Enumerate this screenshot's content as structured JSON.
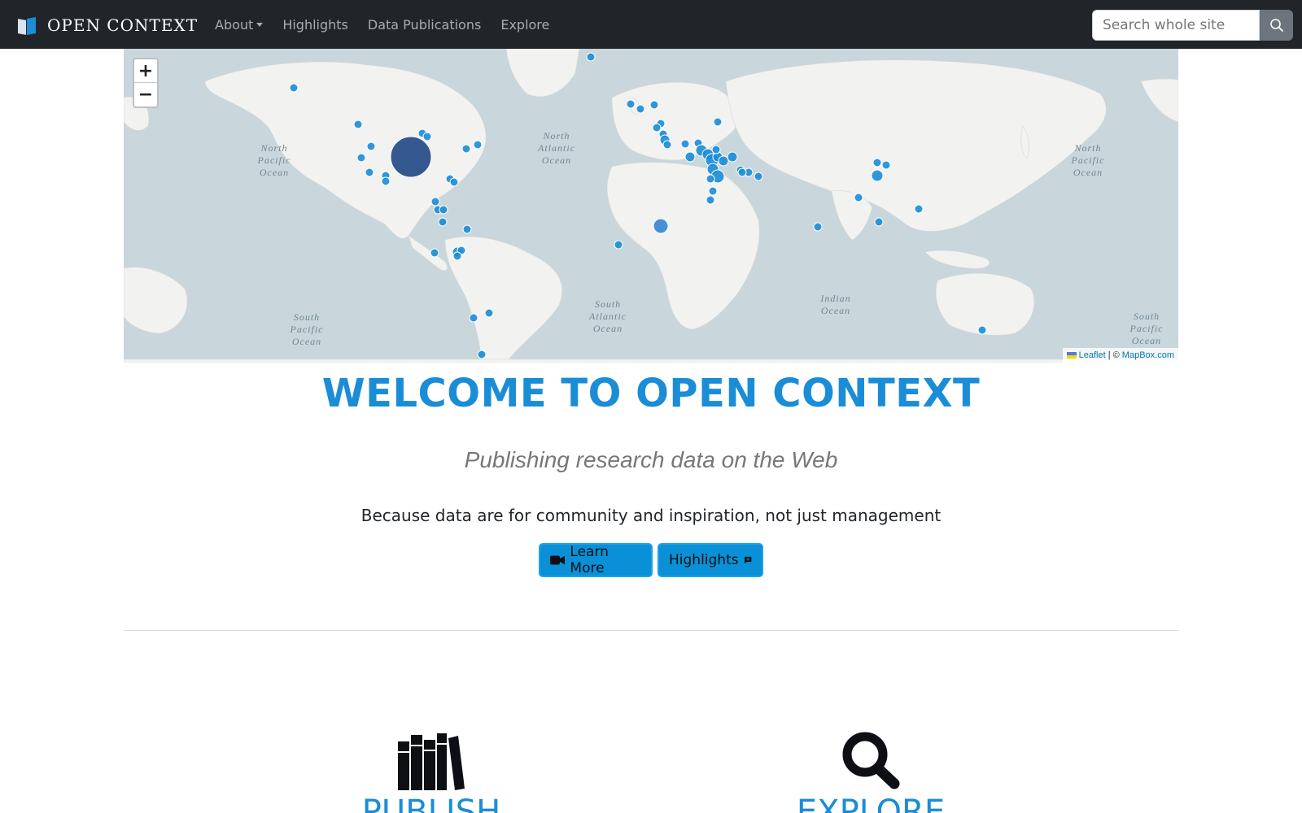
{
  "navbar": {
    "brand": "OPEN CONTEXT",
    "links": [
      {
        "label": "About",
        "dropdown": true
      },
      {
        "label": "Highlights",
        "dropdown": false
      },
      {
        "label": "Data Publications",
        "dropdown": false
      },
      {
        "label": "Explore",
        "dropdown": false
      }
    ],
    "search_placeholder": "Search whole site",
    "search_icon": "search-icon"
  },
  "map": {
    "zoom_in": "+",
    "zoom_out": "−",
    "attribution": {
      "leaflet": "Leaflet",
      "separator": " | © ",
      "provider": "MapBox.com"
    },
    "oceans": [
      "North Pacific Ocean",
      "North Atlantic Ocean",
      "North Pacific Ocean",
      "South Pacific Ocean",
      "South Atlantic Ocean",
      "Indian Ocean",
      "South Pacific Ocean"
    ],
    "marker_color": "#1a8dd6",
    "large_marker_color": "#2a4f8a"
  },
  "hero": {
    "title": "WELCOME TO OPEN CONTEXT",
    "subtitle": "Publishing research data on the Web",
    "tagline": "Because data are for community and inspiration, not just management",
    "learn_more": "Learn More",
    "highlights": "Highlights"
  },
  "features": {
    "publish": "PUBLISH",
    "explore": "EXPLORE"
  },
  "colors": {
    "brand_blue": "#1a8dd6",
    "navbar_bg": "#212529"
  }
}
